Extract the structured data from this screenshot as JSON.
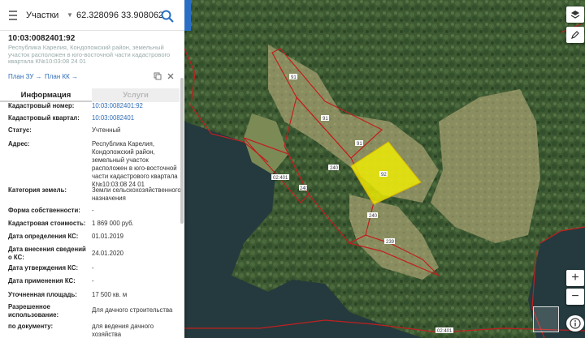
{
  "topbar": {
    "layer_select": "Участки",
    "coords_query": "62.328096 33.908062"
  },
  "parcel": {
    "cad_number": "10:03:0082401:92",
    "description": "Республика Карелия, Кондопожский район, земельный участок расположен в юго-восточной части кадастрового квартала К№10:03:08 24 01"
  },
  "links": {
    "plan_zu": "План ЗУ →",
    "plan_kk": "План КК →"
  },
  "tabs": {
    "info": "Информация",
    "services": "Услуги"
  },
  "info": {
    "cad_number_label": "Кадастровый номер:",
    "cad_number_value": "10:03:0082401:92",
    "cad_block_label": "Кадастровый квартал:",
    "cad_block_value": "10:03:0082401",
    "status_label": "Статус:",
    "status_value": "Учтенный",
    "address_label": "Адрес:",
    "address_value": "Республика Карелия, Кондопожский район, земельный участок расположен в юго-восточной части кадастрового квартала К№10:03:08 24 01",
    "category_label": "Категория земель:",
    "category_value": "Земли сельскохозяйственного назначения",
    "ownership_label": "Форма собственности:",
    "ownership_value": "-",
    "cost_label": "Кадастровая стоимость:",
    "cost_value": "1 869 000 руб.",
    "cost_date_label": "Дата определения КС:",
    "cost_date_value": "01.01.2019",
    "entry_date_label": "Дата внесения сведений о КС:",
    "entry_date_value": "24.01.2020",
    "approval_date_label": "Дата утверждения КС:",
    "approval_date_value": "-",
    "apply_date_label": "Дата применения КС:",
    "apply_date_value": "-",
    "area_label": "Уточненная площадь:",
    "area_value": "17 500 кв. м",
    "permitted_label": "Разрешенное использование:",
    "permitted_value": "Для дачного строительства",
    "by_doc_label": "по документу:",
    "by_doc_value": "для ведения дачного хозяйства"
  },
  "map_labels": {
    "l91": "91",
    "l240a": "240",
    "l92": "92",
    "l240b": "240",
    "l239": "239",
    "l240c": "240",
    "block_a": "02:401",
    "block_b": "02:401"
  },
  "colors": {
    "accent": "#2b6fc4",
    "link": "#2f6db8",
    "selected_parcel": "#f2f000",
    "parcel_border": "#c02020"
  }
}
